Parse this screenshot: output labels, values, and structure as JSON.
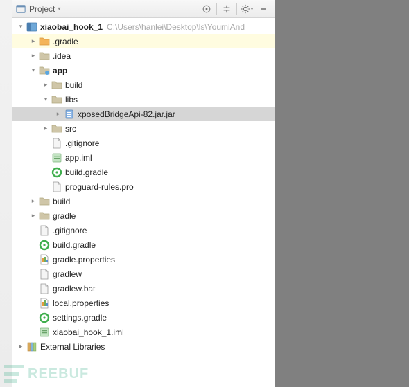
{
  "toolbar": {
    "view_label": "Project"
  },
  "tree": [
    {
      "depth": 0,
      "arrow": "expanded",
      "icon": "module",
      "label": "xiaobai_hook_1",
      "suffix": "C:\\Users\\hanlei\\Desktop\\ls\\YoumiAnd",
      "hl": "",
      "bold": true
    },
    {
      "depth": 1,
      "arrow": "collapsed",
      "icon": "folder-orange",
      "label": ".gradle",
      "hl": "yellow"
    },
    {
      "depth": 1,
      "arrow": "collapsed",
      "icon": "folder",
      "label": ".idea",
      "hl": ""
    },
    {
      "depth": 1,
      "arrow": "expanded",
      "icon": "folder-mod",
      "label": "app",
      "hl": "",
      "bold": true
    },
    {
      "depth": 2,
      "arrow": "collapsed",
      "icon": "folder",
      "label": "build",
      "hl": ""
    },
    {
      "depth": 2,
      "arrow": "expanded",
      "icon": "folder",
      "label": "libs",
      "hl": ""
    },
    {
      "depth": 3,
      "arrow": "collapsed",
      "icon": "jar",
      "label": "xposedBridgeApi-82.jar.jar",
      "hl": "sel"
    },
    {
      "depth": 2,
      "arrow": "collapsed",
      "icon": "folder",
      "label": "src",
      "hl": ""
    },
    {
      "depth": 2,
      "arrow": "none",
      "icon": "file",
      "label": ".gitignore",
      "hl": ""
    },
    {
      "depth": 2,
      "arrow": "none",
      "icon": "iml",
      "label": "app.iml",
      "hl": ""
    },
    {
      "depth": 2,
      "arrow": "none",
      "icon": "gradle",
      "label": "build.gradle",
      "hl": ""
    },
    {
      "depth": 2,
      "arrow": "none",
      "icon": "file",
      "label": "proguard-rules.pro",
      "hl": ""
    },
    {
      "depth": 1,
      "arrow": "collapsed",
      "icon": "folder",
      "label": "build",
      "hl": ""
    },
    {
      "depth": 1,
      "arrow": "collapsed",
      "icon": "folder",
      "label": "gradle",
      "hl": ""
    },
    {
      "depth": 1,
      "arrow": "none",
      "icon": "file",
      "label": ".gitignore",
      "hl": ""
    },
    {
      "depth": 1,
      "arrow": "none",
      "icon": "gradle",
      "label": "build.gradle",
      "hl": ""
    },
    {
      "depth": 1,
      "arrow": "none",
      "icon": "props",
      "label": "gradle.properties",
      "hl": ""
    },
    {
      "depth": 1,
      "arrow": "none",
      "icon": "file",
      "label": "gradlew",
      "hl": ""
    },
    {
      "depth": 1,
      "arrow": "none",
      "icon": "file",
      "label": "gradlew.bat",
      "hl": ""
    },
    {
      "depth": 1,
      "arrow": "none",
      "icon": "props",
      "label": "local.properties",
      "hl": ""
    },
    {
      "depth": 1,
      "arrow": "none",
      "icon": "gradle",
      "label": "settings.gradle",
      "hl": ""
    },
    {
      "depth": 1,
      "arrow": "none",
      "icon": "iml",
      "label": "xiaobai_hook_1.iml",
      "hl": ""
    },
    {
      "depth": 0,
      "arrow": "collapsed",
      "icon": "lib",
      "label": "External Libraries",
      "hl": ""
    }
  ],
  "watermark": "REEBUF"
}
